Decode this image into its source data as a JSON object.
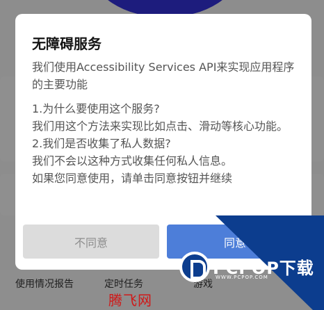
{
  "background_app": {
    "bottom_items": [
      "使用情况报告",
      "定时任务",
      "游戏"
    ],
    "site_mark": "腾飞网"
  },
  "dialog": {
    "title": "无障碍服务",
    "intro": "我们使用Accessibility Services API来实现应用程序的主要功能",
    "q1": "1.为什么要使用这个服务?",
    "a1": "我们用这个方法来实现比如点击、滑动等核心功能。",
    "q2": "2.我们是否收集了私人数据?",
    "a2": "我们不会以这种方式收集任何私人信息。",
    "consent": "如果您同意使用，请单击同意按钮并继续",
    "disagree_label": "不同意",
    "agree_label": "同意"
  },
  "watermark": {
    "brand": "PCPOP下载",
    "sub": "WWW.PCPOP.COM"
  },
  "colors": {
    "agree_button": "#4d7ed9",
    "disagree_button": "#dcdcdc",
    "watermark_blue": "#0c3d8e"
  }
}
